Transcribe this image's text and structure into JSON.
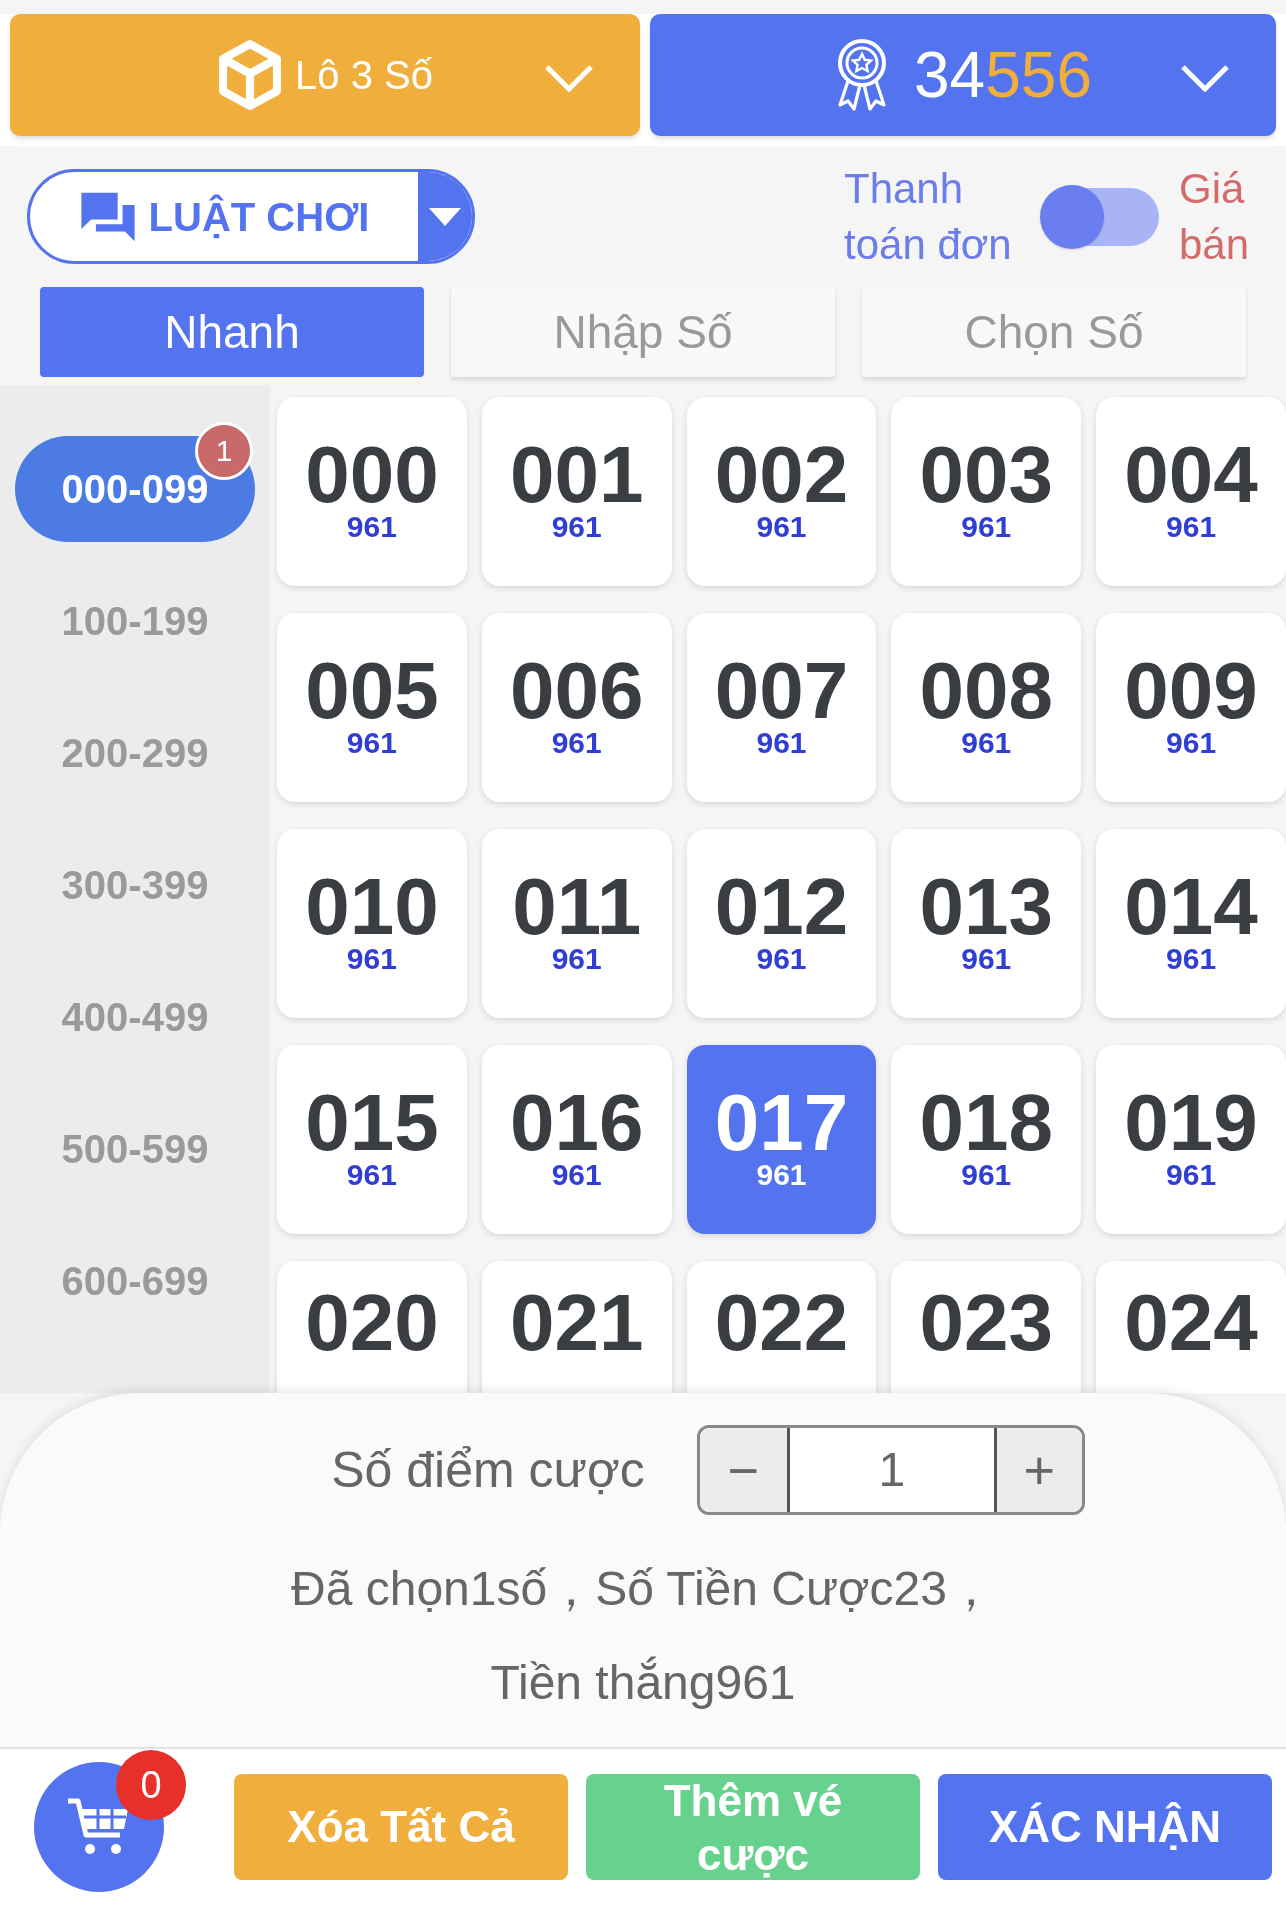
{
  "header": {
    "game": {
      "label": "Lô 3 Số"
    },
    "period": {
      "prefix": "34",
      "highlight": "556"
    }
  },
  "rules_button": {
    "label": "LUẬT CHƠI"
  },
  "toggle": {
    "left_label": "Thanh toán đơn",
    "right_label": "Giá bán",
    "on": false
  },
  "tabs": [
    {
      "label": "Nhanh",
      "selected": true
    },
    {
      "label": "Nhập Số",
      "selected": false
    },
    {
      "label": "Chọn Số",
      "selected": false
    }
  ],
  "ranges": [
    {
      "label": "000-099",
      "selected": true,
      "badge": "1"
    },
    {
      "label": "100-199",
      "selected": false
    },
    {
      "label": "200-299",
      "selected": false
    },
    {
      "label": "300-399",
      "selected": false
    },
    {
      "label": "400-499",
      "selected": false
    },
    {
      "label": "500-599",
      "selected": false
    },
    {
      "label": "600-699",
      "selected": false
    }
  ],
  "numbers": [
    {
      "number": "000",
      "payout": "961",
      "selected": false
    },
    {
      "number": "001",
      "payout": "961",
      "selected": false
    },
    {
      "number": "002",
      "payout": "961",
      "selected": false
    },
    {
      "number": "003",
      "payout": "961",
      "selected": false
    },
    {
      "number": "004",
      "payout": "961",
      "selected": false
    },
    {
      "number": "005",
      "payout": "961",
      "selected": false
    },
    {
      "number": "006",
      "payout": "961",
      "selected": false
    },
    {
      "number": "007",
      "payout": "961",
      "selected": false
    },
    {
      "number": "008",
      "payout": "961",
      "selected": false
    },
    {
      "number": "009",
      "payout": "961",
      "selected": false
    },
    {
      "number": "010",
      "payout": "961",
      "selected": false
    },
    {
      "number": "011",
      "payout": "961",
      "selected": false
    },
    {
      "number": "012",
      "payout": "961",
      "selected": false
    },
    {
      "number": "013",
      "payout": "961",
      "selected": false
    },
    {
      "number": "014",
      "payout": "961",
      "selected": false
    },
    {
      "number": "015",
      "payout": "961",
      "selected": false
    },
    {
      "number": "016",
      "payout": "961",
      "selected": false
    },
    {
      "number": "017",
      "payout": "961",
      "selected": true
    },
    {
      "number": "018",
      "payout": "961",
      "selected": false
    },
    {
      "number": "019",
      "payout": "961",
      "selected": false
    },
    {
      "number": "020",
      "selected": false
    },
    {
      "number": "021",
      "selected": false
    },
    {
      "number": "022",
      "selected": false
    },
    {
      "number": "023",
      "selected": false
    },
    {
      "number": "024",
      "selected": false
    }
  ],
  "bet": {
    "label": "Số điểm cược",
    "minus": "−",
    "value": "1",
    "plus": "+"
  },
  "summary_lines": [
    "Đã chọn1số，Số Tiền Cược23，",
    "Tiền thắng961"
  ],
  "cart": {
    "count": "0"
  },
  "buttons": [
    {
      "label": "Xóa Tất Cả",
      "kind": "clear"
    },
    {
      "label": "Thêm vé cược",
      "kind": "add"
    },
    {
      "label": "XÁC NHẬN",
      "kind": "confirm"
    }
  ]
}
